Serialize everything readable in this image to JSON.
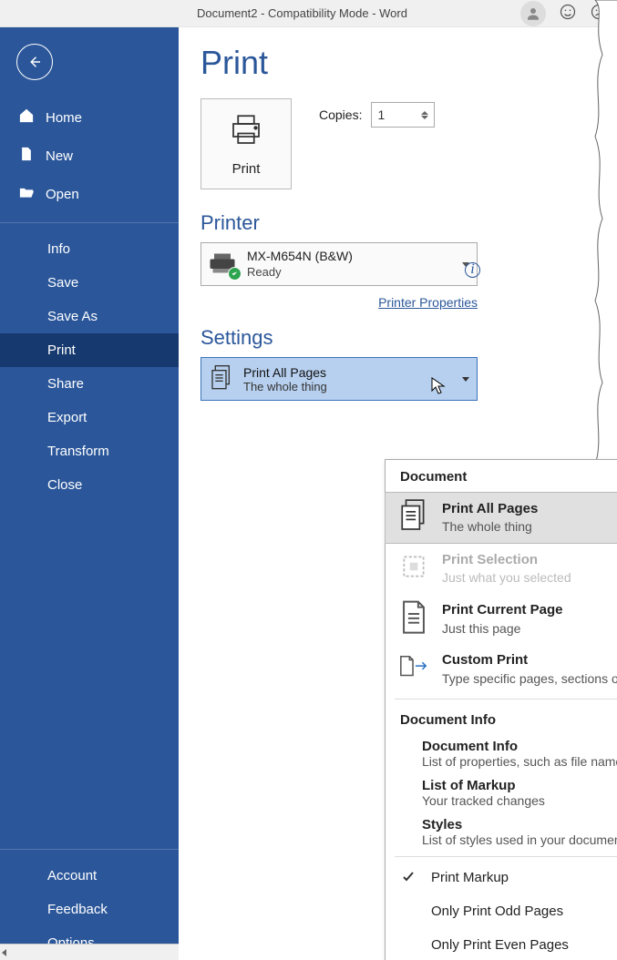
{
  "titlebar": {
    "title": "Document2  -  Compatibility Mode  -  Word"
  },
  "sidebar": {
    "top": [
      {
        "label": "Home",
        "icon": "home"
      },
      {
        "label": "New",
        "icon": "file"
      },
      {
        "label": "Open",
        "icon": "folder"
      }
    ],
    "mid": [
      {
        "label": "Info"
      },
      {
        "label": "Save"
      },
      {
        "label": "Save As"
      },
      {
        "label": "Print",
        "active": true
      },
      {
        "label": "Share"
      },
      {
        "label": "Export"
      },
      {
        "label": "Transform"
      },
      {
        "label": "Close"
      }
    ],
    "bottom": [
      {
        "label": "Account"
      },
      {
        "label": "Feedback"
      },
      {
        "label": "Options"
      }
    ]
  },
  "main": {
    "title": "Print",
    "print_button": "Print",
    "copies_label": "Copies:",
    "copies_value": "1",
    "printer_section": "Printer",
    "printer_name": "MX-M654N (B&W)",
    "printer_status": "Ready",
    "printer_link": "Printer Properties",
    "settings_section": "Settings",
    "settings_selected_title": "Print All Pages",
    "settings_selected_sub": "The whole thing"
  },
  "dropdown": {
    "section1": "Document",
    "items1": [
      {
        "title": "Print All Pages",
        "sub": "The whole thing",
        "highlight": true
      },
      {
        "title": "Print Selection",
        "sub": "Just what you selected",
        "disabled": true
      },
      {
        "title": "Print Current Page",
        "sub": "Just this page"
      },
      {
        "title": "Custom Print",
        "sub": "Type specific pages, sections or ranges"
      }
    ],
    "section2": "Document Info",
    "items2": [
      {
        "title": "Document Info",
        "sub": "List of properties, such as file name, author and title"
      },
      {
        "title": "List of Markup",
        "sub": "Your tracked changes"
      },
      {
        "title": "Styles",
        "sub": "List of styles used in your document"
      }
    ],
    "toggles": [
      {
        "label": "Print Markup",
        "checked": true
      },
      {
        "label": "Only Print Odd Pages",
        "checked": false
      },
      {
        "label": "Only Print Even Pages",
        "checked": false
      }
    ]
  }
}
